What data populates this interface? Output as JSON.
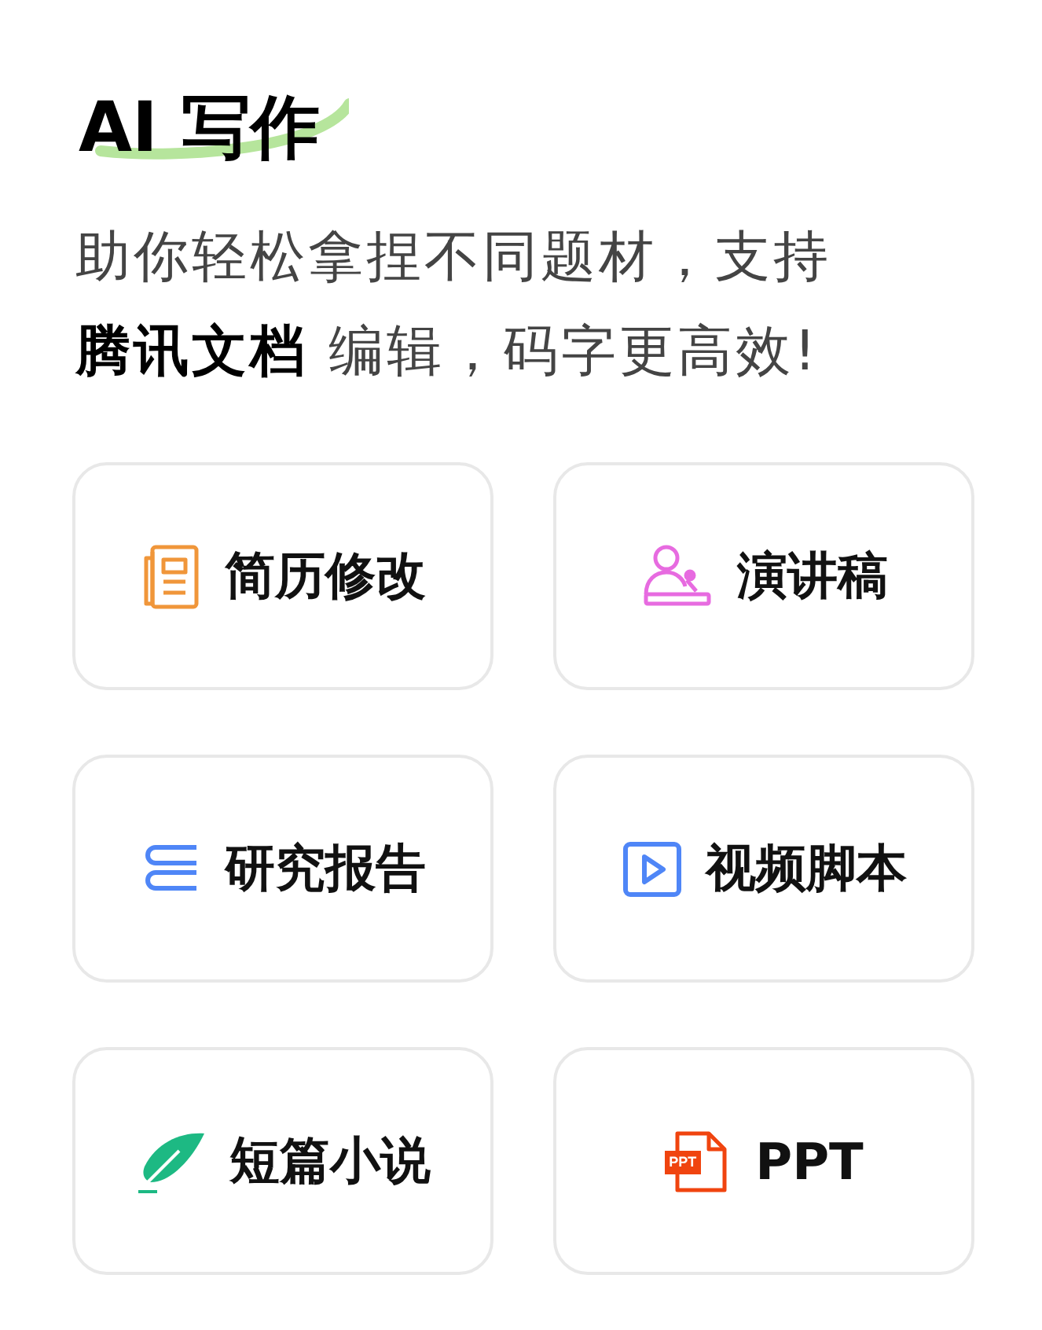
{
  "title": "AI 写作",
  "subtitle": "助你轻松拿捏不同题材，支持**腾讯文档** 编辑，码字更高效!",
  "cards": [
    {
      "label": "简历修改",
      "kind": "resume"
    },
    {
      "label": "演讲稿",
      "kind": "speech"
    },
    {
      "label": "研究报告",
      "kind": "report"
    },
    {
      "label": "视频脚本",
      "kind": "video"
    },
    {
      "label": "短篇小说",
      "kind": "novel"
    },
    {
      "label": "PPT",
      "kind": "ppt",
      "icon_label": "PPT"
    }
  ]
}
